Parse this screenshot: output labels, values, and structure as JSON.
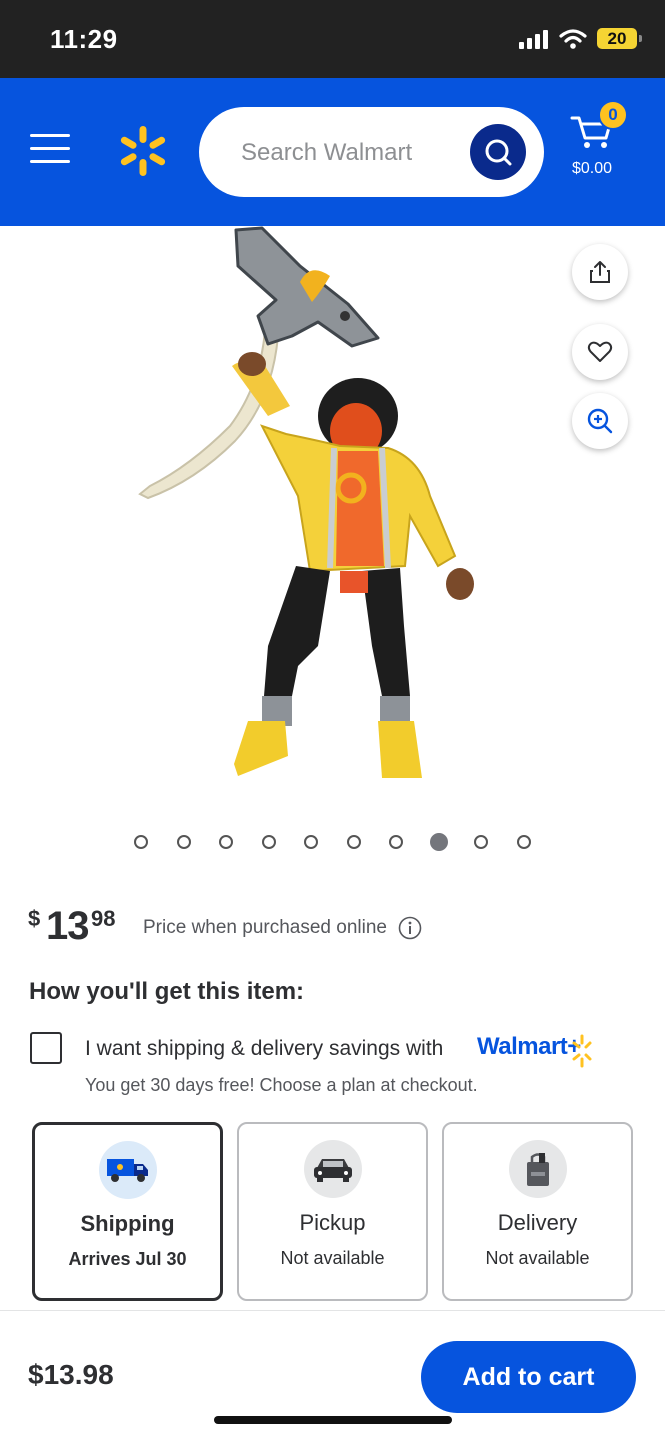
{
  "status_bar": {
    "time": "11:29",
    "battery": "20"
  },
  "header": {
    "search_placeholder": "Search Walmart",
    "cart_count": "0",
    "cart_total": "$0.00",
    "brand_color": "#0654de",
    "accent_color": "#ffc220"
  },
  "gallery": {
    "total_images": 10,
    "active_index": 7
  },
  "price": {
    "currency": "$",
    "dollars": "13",
    "cents": "98",
    "note": "Price when purchased online"
  },
  "fulfillment": {
    "heading": "How you'll get this item:",
    "walmart_plus": {
      "text": "I want shipping & delivery savings with",
      "brand": "Walmart+",
      "subtext": "You get 30 days free! Choose a plan at checkout."
    },
    "options": [
      {
        "title": "Shipping",
        "subtitle": "Arrives Jul 30",
        "selected": true
      },
      {
        "title": "Pickup",
        "subtitle": "Not available",
        "selected": false
      },
      {
        "title": "Delivery",
        "subtitle": "Not available",
        "selected": false
      }
    ]
  },
  "bottom_bar": {
    "price": "$13.98",
    "add_to_cart": "Add to cart"
  }
}
